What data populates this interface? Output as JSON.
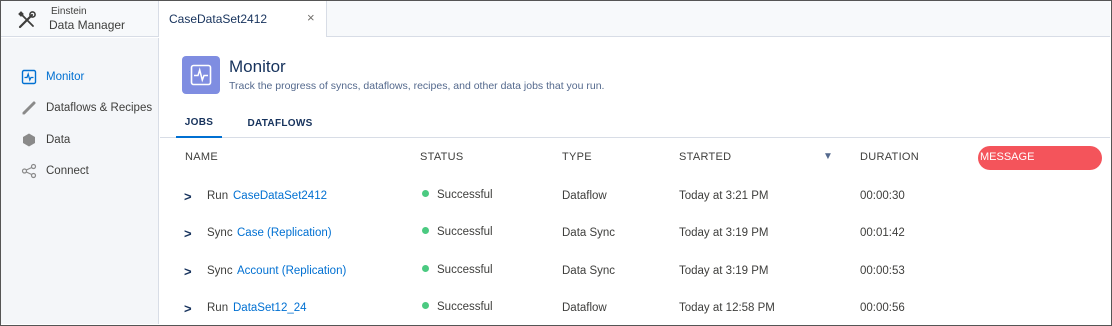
{
  "app": {
    "title_line1": "Einstein",
    "title_line2": "Data Manager",
    "icon": "tools-icon"
  },
  "open_tab": {
    "label": "CaseDataSet2412",
    "close": "×"
  },
  "sidebar": {
    "items": [
      {
        "label": "Monitor",
        "icon": "monitor-icon",
        "active": true
      },
      {
        "label": "Dataflows & Recipes",
        "icon": "pencil-icon",
        "active": false
      },
      {
        "label": "Data",
        "icon": "hexagon-icon",
        "active": false
      },
      {
        "label": "Connect",
        "icon": "share-icon",
        "active": false
      }
    ]
  },
  "header": {
    "title": "Monitor",
    "subtitle": "Track the progress of syncs, dataflows, recipes, and other data jobs that you run.",
    "icon_color": "#7f8de1"
  },
  "job_tabs": [
    {
      "label": "JOBS",
      "active": true
    },
    {
      "label": "DATAFLOWS",
      "active": false
    }
  ],
  "table": {
    "columns": [
      "NAME",
      "STATUS",
      "TYPE",
      "STARTED",
      "DURATION",
      "MESSAGE"
    ],
    "sort_indicator": "▼",
    "message_highlight_color": "#f4545b",
    "rows": [
      {
        "kind": "Run",
        "name": "CaseDataSet2412",
        "status": "Successful",
        "type": "Dataflow",
        "started": "Today at 3:21 PM",
        "duration": "00:00:30"
      },
      {
        "kind": "Sync",
        "name": "Case (Replication)",
        "status": "Successful",
        "type": "Data Sync",
        "started": "Today at 3:19 PM",
        "duration": "00:01:42"
      },
      {
        "kind": "Sync",
        "name": "Account (Replication)",
        "status": "Successful",
        "type": "Data Sync",
        "started": "Today at 3:19 PM",
        "duration": "00:00:53"
      },
      {
        "kind": "Run",
        "name": "DataSet12_24",
        "status": "Successful",
        "type": "Dataflow",
        "started": "Today at 12:58 PM",
        "duration": "00:00:56"
      }
    ]
  },
  "colors": {
    "accent": "#0070d2",
    "success": "#4bca81",
    "text": "#16325c"
  }
}
